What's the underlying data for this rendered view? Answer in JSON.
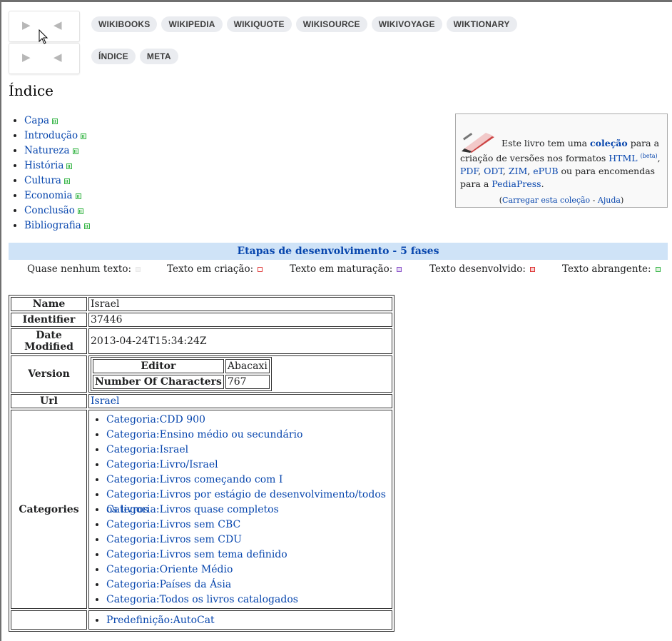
{
  "nav": {
    "next_glyph": "▶",
    "prev_glyph": "◀"
  },
  "project_links_row1": [
    "WIKIBOOKS",
    "WIKIPEDIA",
    "WIKIQUOTE",
    "WIKISOURCE",
    "WIKIVOYAGE",
    "WIKTIONARY"
  ],
  "project_links_row2": [
    "ÍNDICE",
    "META"
  ],
  "title": "Índice",
  "toc": [
    "Capa",
    "Introdução",
    "Natureza",
    "História",
    "Cultura",
    "Economia",
    "Conclusão",
    "Bibliografia"
  ],
  "collection_box": {
    "t1": "Este livro tem uma ",
    "t_coll": "coleção",
    "t2": " para a criação de versões nos formatos ",
    "html": "HTML",
    "beta": "(beta)",
    "pdf": "PDF",
    "odt": "ODT",
    "zim": "ZIM",
    "epub": "ePUB",
    "t3": " ou para encomendas para a ",
    "pediapress": "PediaPress",
    "t4": ".",
    "foot_open": "(",
    "load": "Carregar esta coleção",
    "sep": " - ",
    "help": "Ajuda",
    "foot_close": ")"
  },
  "stages": {
    "title": "Etapas de desenvolvimento - 5 fases",
    "items": [
      {
        "label": "Quase nenhum texto:",
        "color": "#e0e0e0"
      },
      {
        "label": "Texto em criação:",
        "color": "#e04040"
      },
      {
        "label": "Texto em maturação:",
        "color": "#8a4fc9"
      },
      {
        "label": "Texto desenvolvido:",
        "color": "#d33"
      },
      {
        "label": "Texto abrangente:",
        "color": "#39b54a"
      }
    ]
  },
  "metadata": {
    "name_label": "Name",
    "name_value": "Israel",
    "id_label": "Identifier",
    "id_value": "37446",
    "date_label": "Date Modified",
    "date_value": "2013-04-24T15:34:24Z",
    "version_label": "Version",
    "editor_label": "Editor",
    "editor_value": "Abacaxi",
    "chars_label": "Number Of Characters",
    "chars_value": "767",
    "url_label": "Url",
    "url_value": "Israel",
    "categories_label": "Categories",
    "categories": [
      "Categoria:CDD 900",
      "Categoria:Ensino médio ou secundário",
      "Categoria:Israel",
      "Categoria:Livro/Israel",
      "Categoria:Livros começando com I",
      "Categoria:Livros por estágio de desenvolvimento/todos os livros",
      "Categoria:Livros quase completos",
      "Categoria:Livros sem CBC",
      "Categoria:Livros sem CDU",
      "Categoria:Livros sem tema definido",
      "Categoria:Oriente Médio",
      "Categoria:Países da Ásia",
      "Categoria:Todos os livros catalogados"
    ],
    "templates": [
      "Predefinição:AutoCat"
    ]
  }
}
